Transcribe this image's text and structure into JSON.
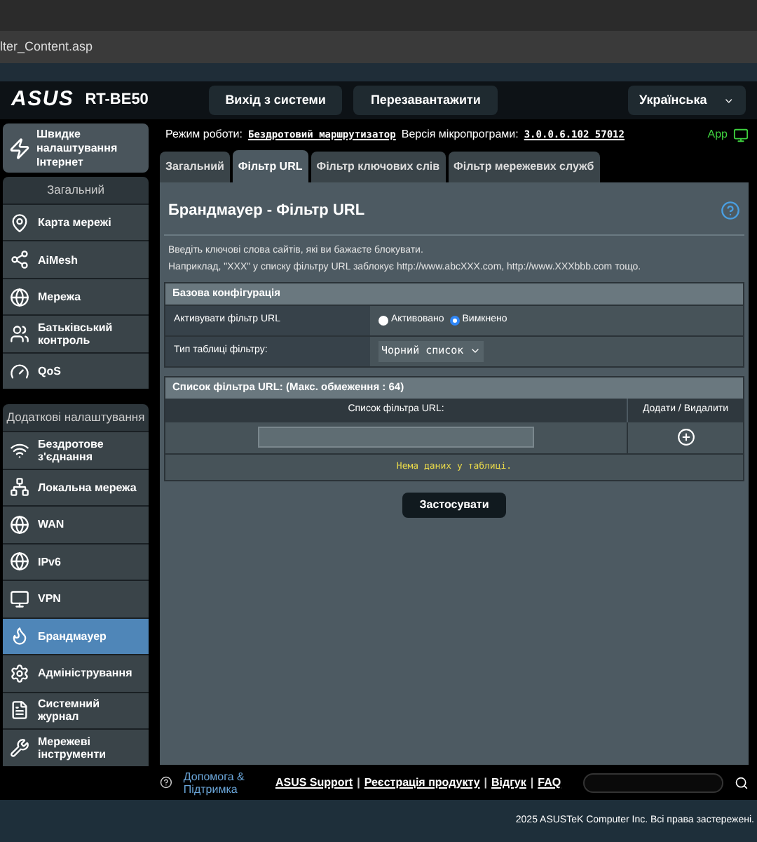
{
  "browser": {
    "address": "lter_Content.asp"
  },
  "header": {
    "logo": "ASUS",
    "model": "RT-BE50",
    "buttons": [
      "Вихід з системи",
      "Перезавантажити"
    ],
    "language": "Українська"
  },
  "status": {
    "mode_label": "Режим роботи:",
    "mode": "Бездротовий маршрутизатор",
    "fw_label": "Версія мікропрограми:",
    "fw": "3.0.0.6.102_57012",
    "app": "App"
  },
  "sidebar": {
    "quick": "Швидке налаштування Інтернет",
    "sections": [
      {
        "title": "Загальний",
        "items": [
          {
            "label": "Карта мережі",
            "selected": false
          },
          {
            "label": "AiMesh",
            "selected": false
          },
          {
            "label": "Мережа",
            "selected": false
          },
          {
            "label": "Батьківський контроль",
            "selected": false
          },
          {
            "label": "QoS",
            "selected": false
          }
        ]
      },
      {
        "title": "Додаткові налаштування",
        "items": [
          {
            "label": "Бездротове з'єднання",
            "selected": false
          },
          {
            "label": "Локальна мережа",
            "selected": false
          },
          {
            "label": "WAN",
            "selected": false
          },
          {
            "label": "IPv6",
            "selected": false
          },
          {
            "label": "VPN",
            "selected": false
          },
          {
            "label": "Брандмауер",
            "selected": true
          },
          {
            "label": "Адміністрування",
            "selected": false
          },
          {
            "label": "Системний журнал",
            "selected": false
          },
          {
            "label": "Мережеві інструменти",
            "selected": false
          }
        ]
      }
    ]
  },
  "tabs": [
    {
      "label": "Загальний",
      "selected": false
    },
    {
      "label": "Фільтр URL",
      "selected": true
    },
    {
      "label": "Фільтр ключових слів",
      "selected": false
    },
    {
      "label": "Фільтр мережевих служб",
      "selected": false
    }
  ],
  "page": {
    "title": "Брандмауер - Фільтр URL",
    "intro": [
      "Введіть ключові слова сайтів, які ви бажаєте блокувати.",
      "Наприклад, \"XXX\" у списку фільтру URL заблокує http://www.abcXXX.com, http://www.XXXbbb.com тощо."
    ]
  },
  "basic": {
    "title": "Базова конфігурація",
    "enable_label": "Активувати фільтр URL",
    "options": [
      {
        "label": "Активовано",
        "selected": false
      },
      {
        "label": "Вимкнено",
        "selected": true
      }
    ],
    "type_label": "Тип таблиці фільтру:",
    "type_value": "Чорний список"
  },
  "list": {
    "title": "Список фільтра URL: (Макс. обмеження : 64)",
    "columns": [
      "Список фільтра URL:",
      "Додати / Видалити"
    ],
    "empty": "Нема даних у таблиці."
  },
  "apply": "Застосувати",
  "footer": {
    "help": "Допомога & Підтримка",
    "links": [
      "ASUS Support",
      "Реєстрація продукту",
      "Відгук",
      "FAQ"
    ],
    "separators": [
      "|",
      "|",
      "|"
    ],
    "copyright": "2025 ASUSTeK Computer Inc. Всі права застережені."
  }
}
